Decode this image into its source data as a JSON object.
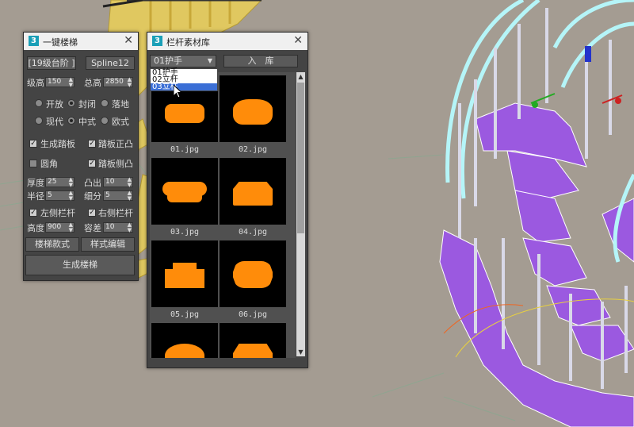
{
  "left_window": {
    "title": "一键楼梯",
    "step_button": "[19级台阶 ]",
    "spline_button": "Spline12",
    "step_height_label": "级高",
    "step_height_value": "150",
    "total_height_label": "总高",
    "total_height_value": "2850",
    "radio_open": "开放",
    "radio_closed": "封闭",
    "radio_floor": "落地",
    "radio_modern": "现代",
    "radio_chinese": "中式",
    "radio_european": "欧式",
    "chk_gen_plate": "生成踏板",
    "chk_plate_front": "踏板正凸",
    "chk_round": "圆角",
    "chk_plate_side": "踏板侧凸",
    "thickness_label": "厚度",
    "thickness_value": "25",
    "protrude_label": "凸出",
    "protrude_value": "10",
    "radius_label": "半径",
    "radius_value": "5",
    "subdiv_label": "细分",
    "subdiv_value": "5",
    "chk_left_rail": "左侧栏杆",
    "chk_right_rail": "右侧栏杆",
    "height_label": "高度",
    "height_value": "900",
    "tolerance_label": "容差",
    "tolerance_value": "10",
    "style_button": "楼梯款式",
    "edit_button": "样式编辑",
    "generate_button": "生成楼梯"
  },
  "library_window": {
    "title": "栏杆素材库",
    "dropdown_value": "01护手",
    "import_button": "入　库",
    "options": [
      "01护手",
      "02立杆",
      "03立柱"
    ],
    "thumbnails": [
      "01.jpg",
      "02.jpg",
      "03.jpg",
      "04.jpg",
      "05.jpg",
      "06.jpg"
    ]
  },
  "colors": {
    "stair_purple": "#9b59e0",
    "railing_cyan": "#b5f5f8",
    "accent_orange": "#ff8c0a",
    "selection_blue": "#3b6fd6"
  }
}
